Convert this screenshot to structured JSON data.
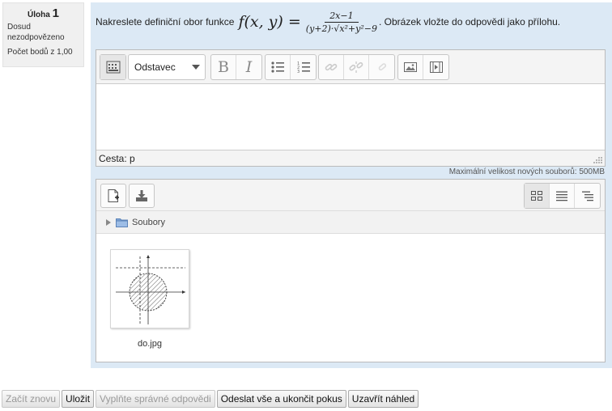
{
  "question_info": {
    "label": "Úloha",
    "number": "1",
    "state": "Dosud nezodpovězeno",
    "grade": "Počet bodů z 1,00"
  },
  "question_text": {
    "prefix": "Nakreslete definiční obor funkce",
    "formula_lhs": "f(x, y) =",
    "formula_numerator": "2x−1",
    "formula_denominator": "(y+2)·√x²+y²−9",
    "suffix": ". Obrázek vložte do odpovědi jako přílohu."
  },
  "editor": {
    "paragraph_select": "Odstavec",
    "bold_label": "B",
    "italic_label": "I",
    "path_label": "Cesta: p"
  },
  "filemanager": {
    "max_size": "Maximální velikost nových souborů: 500MB",
    "folder_label": "Soubory",
    "file_name": "do.jpg"
  },
  "buttons": {
    "restart": "Začít znovu",
    "save": "Uložit",
    "fill_correct": "Vyplňte správné odpovědi",
    "submit_all": "Odeslat vše a ukončit  pokus",
    "close_preview": "Uzavřít náhled"
  }
}
